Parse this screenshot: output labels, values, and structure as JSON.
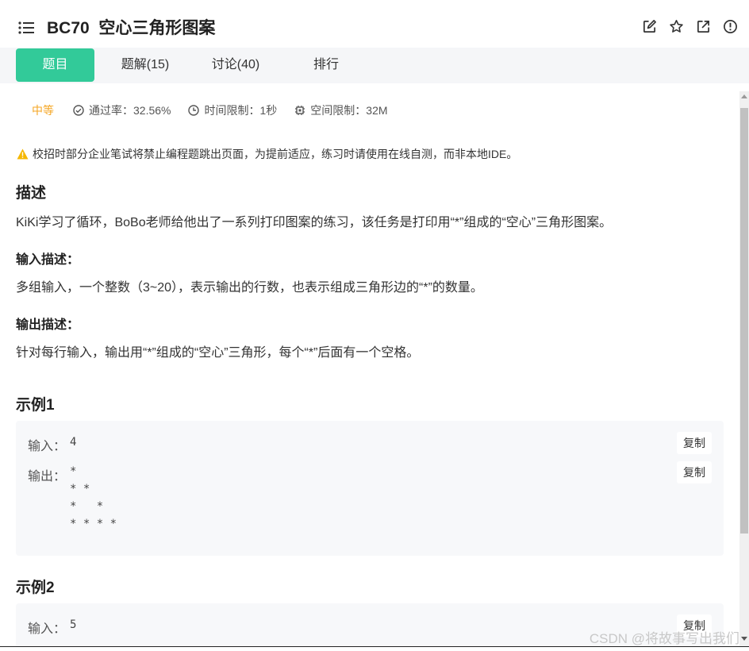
{
  "header": {
    "title": "BC70  空心三角形图案",
    "icons": [
      "menu-icon",
      "edit-icon",
      "star-icon",
      "external-link-icon",
      "info-icon"
    ]
  },
  "tabs": [
    {
      "label": "题目",
      "active": true
    },
    {
      "label": "题解(15)",
      "active": false
    },
    {
      "label": "讨论(40)",
      "active": false
    },
    {
      "label": "排行",
      "active": false
    }
  ],
  "meta": {
    "difficulty": "中等",
    "pass_rate": "通过率：32.56%",
    "time_limit": "时间限制：1秒",
    "space_limit": "空间限制：32M"
  },
  "notice": "校招时部分企业笔试将禁止编程题跳出页面，为提前适应，练习时请使用在线自测，而非本地IDE。",
  "description": {
    "heading": "描述",
    "text": "KiKi学习了循环，BoBo老师给他出了一系列打印图案的练习，该任务是打印用“*”组成的“空心”三角形图案。"
  },
  "input_desc": {
    "heading": "输入描述：",
    "text": "多组输入，一个整数（3~20），表示输出的行数，也表示组成三角形边的“*”的数量。"
  },
  "output_desc": {
    "heading": "输出描述：",
    "text": "针对每行输入，输出用“*”组成的“空心”三角形，每个“*”后面有一个空格。"
  },
  "example1": {
    "heading": "示例1",
    "input_label": "输入：",
    "input_value": "4",
    "output_label": "输出：",
    "output_value": "*\n* *\n*   *\n* * * *",
    "copy_label": "复制"
  },
  "example2": {
    "heading": "示例2",
    "input_label": "输入：",
    "input_value": "5",
    "copy_label": "复制"
  },
  "watermark": "CSDN @将故事写出我们",
  "colors": {
    "accent": "#32ca99",
    "difficulty": "#f5a623",
    "warning": "#f5b700"
  }
}
